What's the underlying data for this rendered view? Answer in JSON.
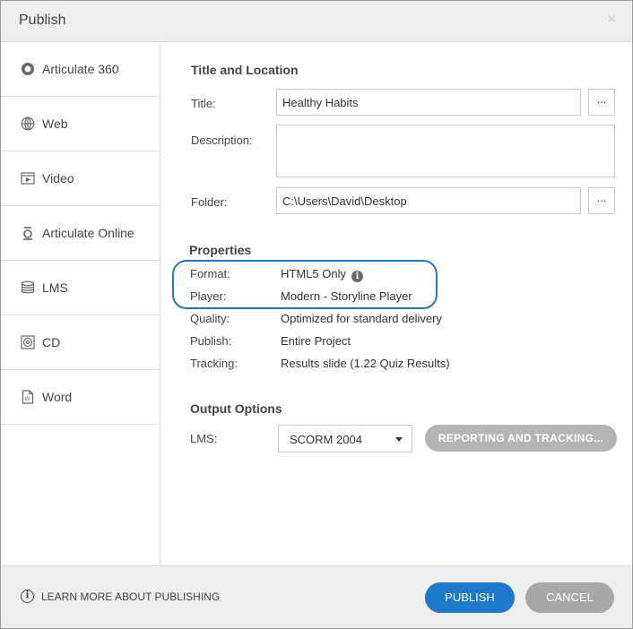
{
  "window": {
    "title": "Publish",
    "close_glyph": "×"
  },
  "sidebar": {
    "items": [
      {
        "label": "Articulate 360",
        "icon": "articulate-360-icon",
        "active": false
      },
      {
        "label": "Web",
        "icon": "globe-icon",
        "active": false
      },
      {
        "label": "Video",
        "icon": "video-icon",
        "active": false
      },
      {
        "label": "Articulate Online",
        "icon": "articulate-online-icon",
        "active": false
      },
      {
        "label": "LMS",
        "icon": "database-icon",
        "active": true
      },
      {
        "label": "CD",
        "icon": "cd-icon",
        "active": false
      },
      {
        "label": "Word",
        "icon": "word-document-icon",
        "active": false
      }
    ]
  },
  "title_location": {
    "heading": "Title and Location",
    "title_label": "Title:",
    "title_value": "Healthy Habits",
    "description_label": "Description:",
    "description_value": "",
    "folder_label": "Folder:",
    "folder_value": "C:\\Users\\David\\Desktop",
    "browse_label": "..."
  },
  "properties": {
    "heading": "Properties",
    "rows": [
      {
        "label": "Format:",
        "value": "HTML5 Only"
      },
      {
        "label": "Player:",
        "value": "Modern - Storyline Player"
      },
      {
        "label": "Quality:",
        "value": "Optimized for standard delivery"
      },
      {
        "label": "Publish:",
        "value": "Entire Project"
      },
      {
        "label": "Tracking:",
        "value": "Results slide (1.22 Quiz Results)"
      }
    ],
    "info_glyph": "i"
  },
  "output": {
    "heading": "Output Options",
    "lms_label": "LMS:",
    "lms_value": "SCORM 2004",
    "reporting_button": "REPORTING AND TRACKING..."
  },
  "footer": {
    "learn_more": "LEARN MORE ABOUT PUBLISHING",
    "info_glyph": "i",
    "publish": "PUBLISH",
    "cancel": "CANCEL"
  },
  "colors": {
    "accent": "#1d79c9",
    "disabled_button": "#b4b4b4",
    "cancel_button": "#a8a8a8"
  }
}
